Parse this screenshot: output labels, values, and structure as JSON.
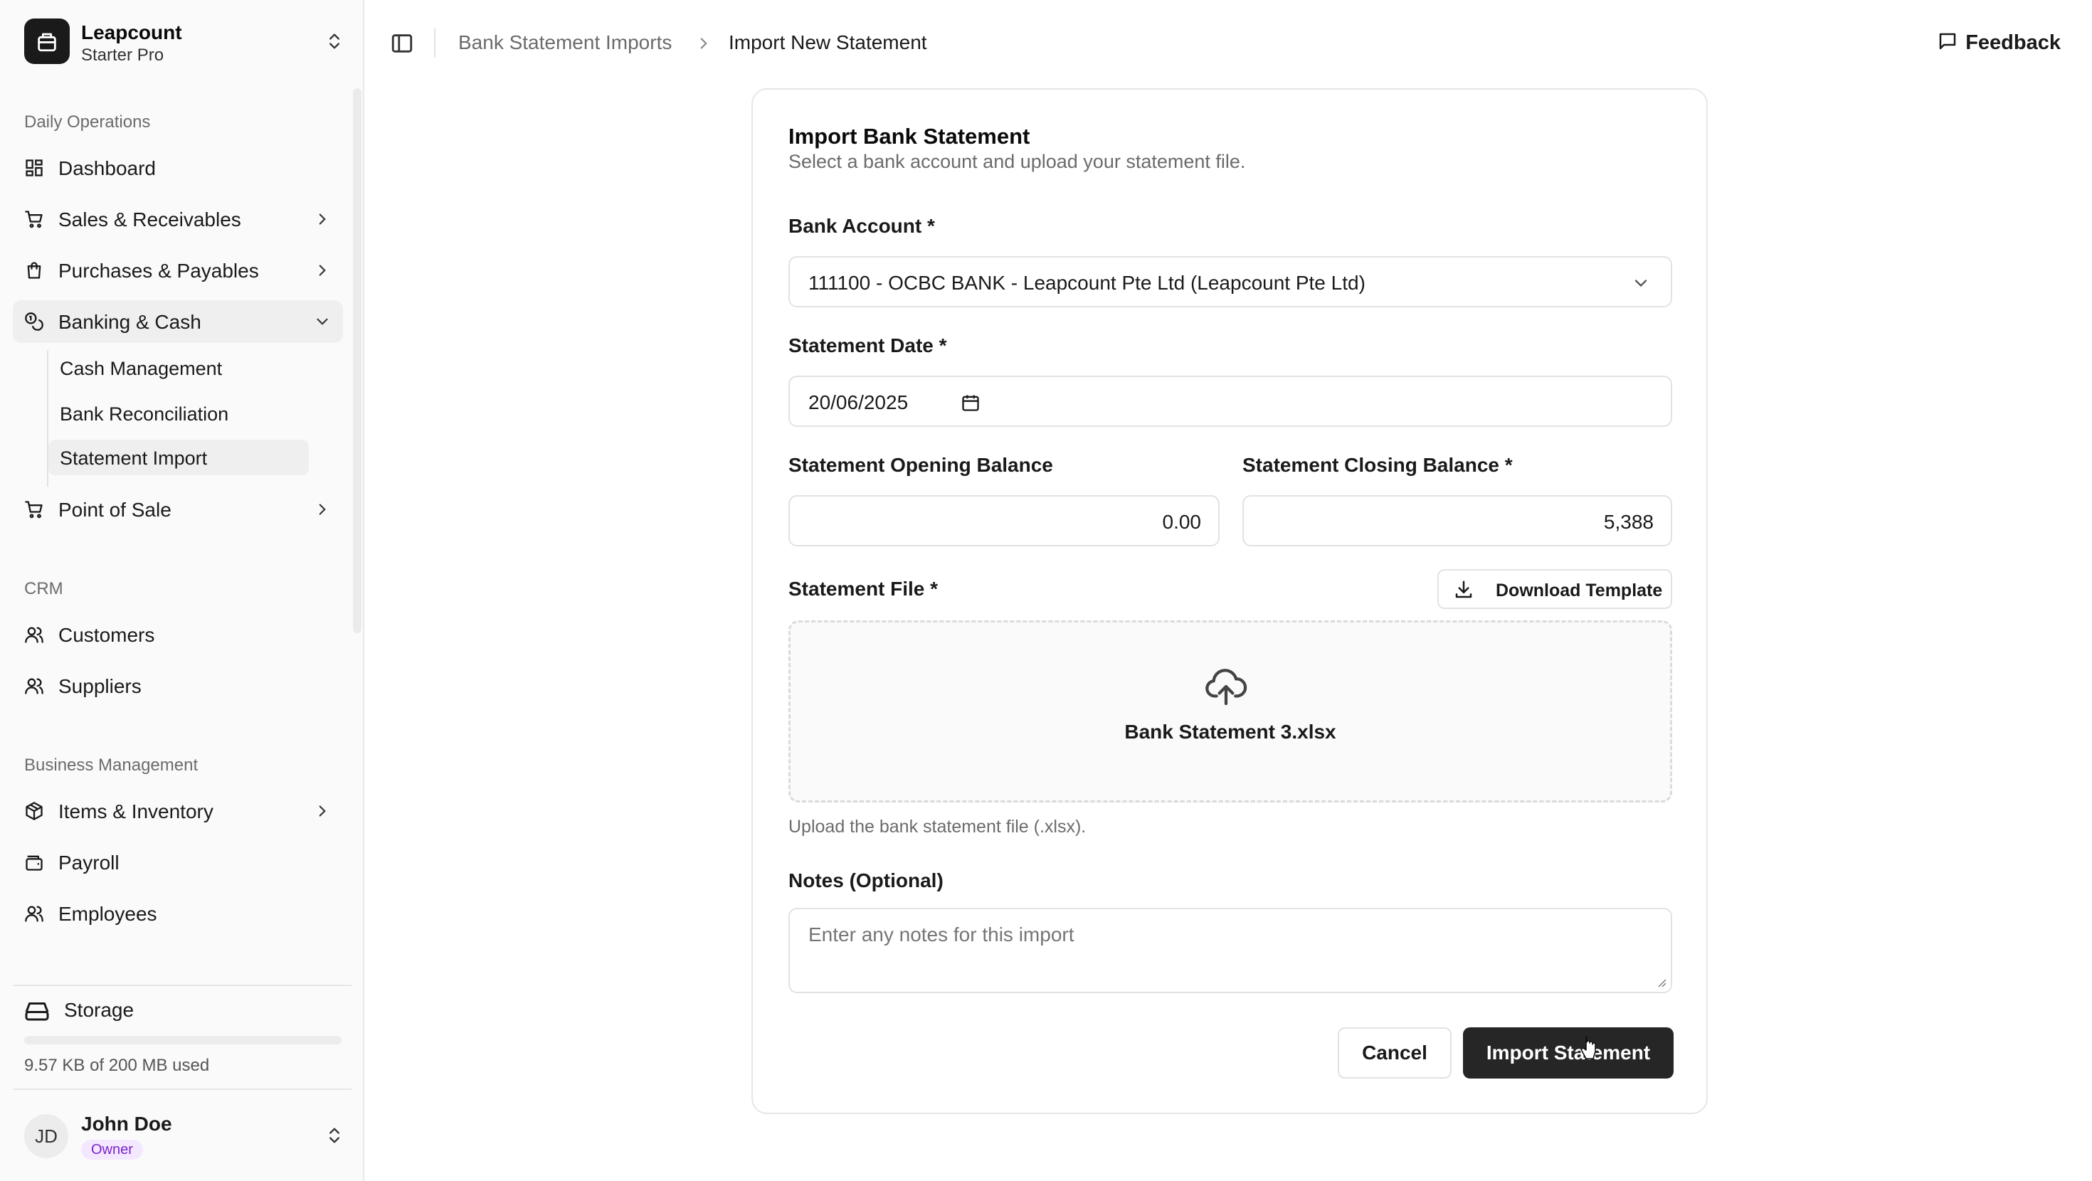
{
  "org": {
    "name": "Leapcount",
    "plan": "Starter Pro"
  },
  "sidebar": {
    "groups": [
      {
        "label": "Daily Operations"
      },
      {
        "label": "CRM"
      },
      {
        "label": "Business Management"
      }
    ],
    "items": [
      {
        "label": "Dashboard",
        "icon": "dashboard-icon"
      },
      {
        "label": "Sales & Receivables",
        "icon": "cart-icon"
      },
      {
        "label": "Purchases & Payables",
        "icon": "shopping-bag-icon"
      },
      {
        "label": "Banking & Cash",
        "icon": "coins-icon",
        "expanded": true
      },
      {
        "label": "Point of Sale",
        "icon": "cart-icon"
      },
      {
        "label": "Customers",
        "icon": "users-icon"
      },
      {
        "label": "Suppliers",
        "icon": "users-icon"
      },
      {
        "label": "Items & Inventory",
        "icon": "package-icon"
      },
      {
        "label": "Payroll",
        "icon": "wallet-icon"
      },
      {
        "label": "Employees",
        "icon": "users-icon"
      }
    ],
    "banking_sub": [
      {
        "label": "Cash Management"
      },
      {
        "label": "Bank Reconciliation"
      },
      {
        "label": "Statement Import",
        "active": true
      }
    ],
    "storage": {
      "label": "Storage",
      "usage": "9.57 KB of 200 MB used",
      "fraction_used": 5e-05
    },
    "user": {
      "initials": "JD",
      "name": "John Doe",
      "role": "Owner"
    }
  },
  "breadcrumb": {
    "parent": "Bank Statement Imports",
    "current": "Import New Statement"
  },
  "header": {
    "feedback_label": "Feedback"
  },
  "form": {
    "title": "Import Bank Statement",
    "description": "Select a bank account and upload your statement file.",
    "bank_account": {
      "label": "Bank Account *",
      "value": "111100 - OCBC BANK - Leapcount Pte Ltd (Leapcount Pte Ltd)"
    },
    "statement_date": {
      "label": "Statement Date *",
      "value": "20/06/2025"
    },
    "opening_balance": {
      "label": "Statement Opening Balance",
      "value": "0.00"
    },
    "closing_balance": {
      "label": "Statement Closing Balance *",
      "value": "5,388"
    },
    "statement_file": {
      "label": "Statement File *",
      "download_label": "Download Template",
      "file_name": "Bank Statement 3.xlsx",
      "help": "Upload the bank statement file (.xlsx)."
    },
    "notes": {
      "label": "Notes (Optional)",
      "placeholder": "Enter any notes for this import"
    },
    "cancel_label": "Cancel",
    "submit_label": "Import Statement"
  },
  "colors": {
    "primary_button": "#262626",
    "role_badge_bg": "#f3e8ff",
    "role_badge_text": "#7e22ce"
  }
}
